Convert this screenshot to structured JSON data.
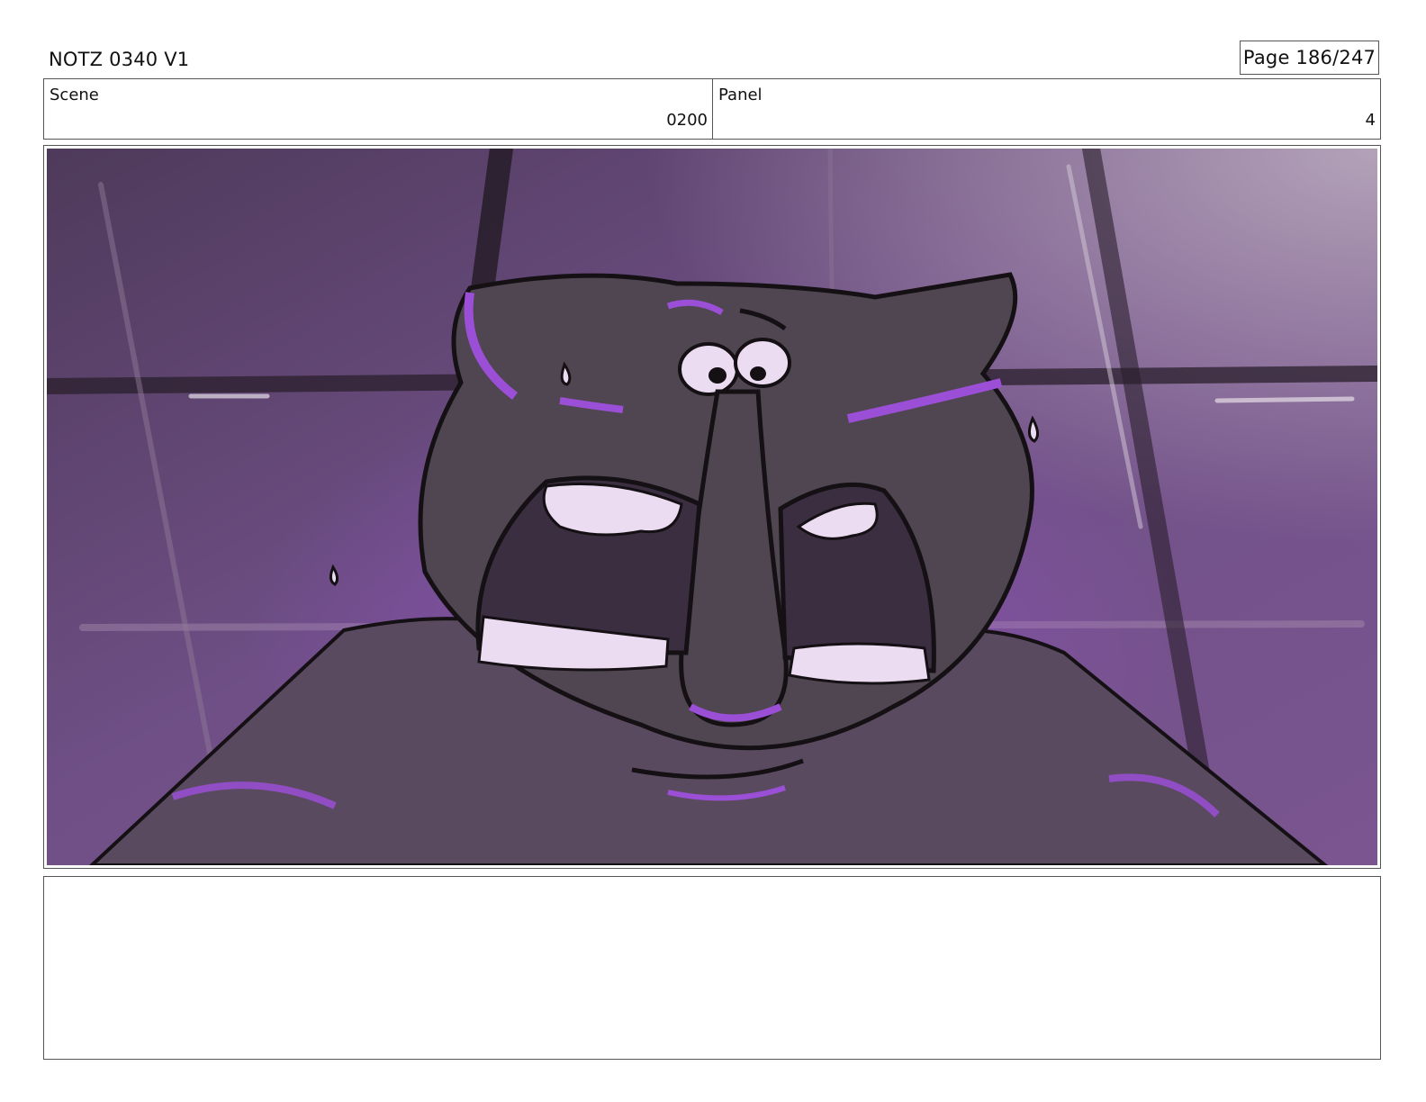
{
  "header": {
    "title": "NOTZ 0340 V1",
    "page_label": "Page 186/247"
  },
  "info": {
    "scene_label": "Scene",
    "scene_value": "0200",
    "panel_label": "Panel",
    "panel_value": "4"
  },
  "artwork": {
    "description_icon": "storyboard-panel-illustration",
    "colors": {
      "background_dark": "#4e3a5a",
      "background_mid": "#6f4f86",
      "background_light": "#a895ad",
      "character_body": "#4f4651",
      "accent_glow": "#9b4fd6",
      "highlight": "#ecdcf2",
      "line": "#141014"
    }
  },
  "notes": {
    "text": ""
  }
}
